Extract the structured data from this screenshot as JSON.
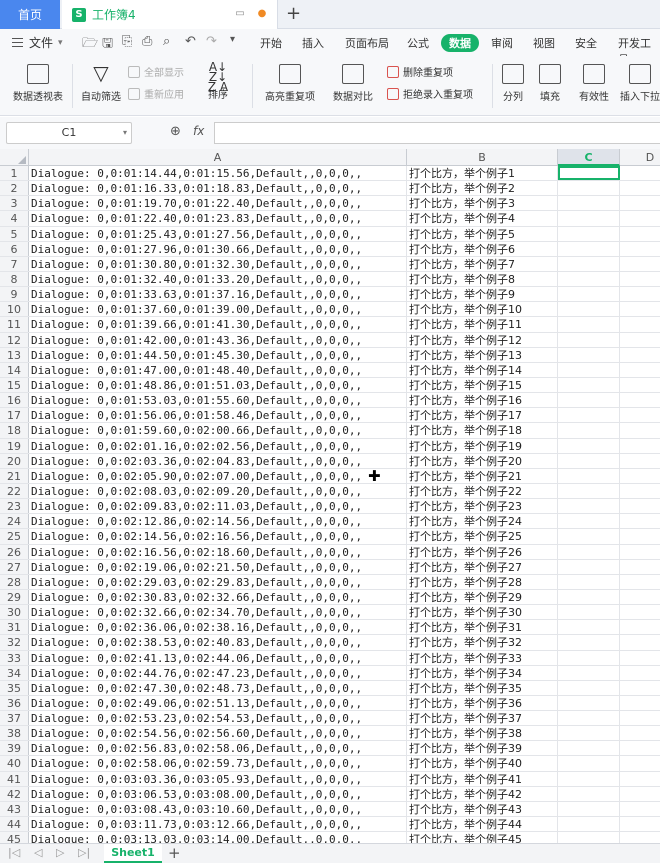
{
  "tabs": {
    "home": "首页",
    "doc_title": "工作簿4",
    "doc_icon": "S"
  },
  "menu": {
    "file": "文件",
    "items": [
      "开始",
      "插入",
      "页面布局",
      "公式",
      "数据",
      "审阅",
      "视图",
      "安全",
      "开发工具"
    ],
    "active": "数据"
  },
  "ribbon": {
    "pivot": "数据透视表",
    "autofilter": "自动筛选",
    "show_all": "全部显示",
    "reapply": "重新应用",
    "sort": "排序",
    "highlight_dup": "高亮重复项",
    "compare": "数据对比",
    "remove_dup": "删除重复项",
    "reject_dup": "拒绝录入重复项",
    "split": "分列",
    "fill": "填充",
    "validity": "有效性",
    "insert_dropdown": "插入下拉"
  },
  "formula_bar": {
    "cell_ref": "C1",
    "fx": "fx",
    "value": ""
  },
  "columns": [
    "A",
    "B",
    "C",
    "D"
  ],
  "selected_column": "C",
  "rows": [
    {
      "n": "1",
      "a": "Dialogue: 0,0:01:14.44,0:01:15.56,Default,,0,0,0,,",
      "b": "打个比方，举个例子1"
    },
    {
      "n": "2",
      "a": "Dialogue: 0,0:01:16.33,0:01:18.83,Default,,0,0,0,,",
      "b": "打个比方，举个例子2"
    },
    {
      "n": "3",
      "a": "Dialogue: 0,0:01:19.70,0:01:22.40,Default,,0,0,0,,",
      "b": "打个比方，举个例子3"
    },
    {
      "n": "4",
      "a": "Dialogue: 0,0:01:22.40,0:01:23.83,Default,,0,0,0,,",
      "b": "打个比方，举个例子4"
    },
    {
      "n": "5",
      "a": "Dialogue: 0,0:01:25.43,0:01:27.56,Default,,0,0,0,,",
      "b": "打个比方，举个例子5"
    },
    {
      "n": "6",
      "a": "Dialogue: 0,0:01:27.96,0:01:30.66,Default,,0,0,0,,",
      "b": "打个比方，举个例子6"
    },
    {
      "n": "7",
      "a": "Dialogue: 0,0:01:30.80,0:01:32.30,Default,,0,0,0,,",
      "b": "打个比方，举个例子7"
    },
    {
      "n": "8",
      "a": "Dialogue: 0,0:01:32.40,0:01:33.20,Default,,0,0,0,,",
      "b": "打个比方，举个例子8"
    },
    {
      "n": "9",
      "a": "Dialogue: 0,0:01:33.63,0:01:37.16,Default,,0,0,0,,",
      "b": "打个比方，举个例子9"
    },
    {
      "n": "10",
      "a": "Dialogue: 0,0:01:37.60,0:01:39.00,Default,,0,0,0,,",
      "b": "打个比方，举个例子10"
    },
    {
      "n": "11",
      "a": "Dialogue: 0,0:01:39.66,0:01:41.30,Default,,0,0,0,,",
      "b": "打个比方，举个例子11"
    },
    {
      "n": "12",
      "a": "Dialogue: 0,0:01:42.00,0:01:43.36,Default,,0,0,0,,",
      "b": "打个比方，举个例子12"
    },
    {
      "n": "13",
      "a": "Dialogue: 0,0:01:44.50,0:01:45.30,Default,,0,0,0,,",
      "b": "打个比方，举个例子13"
    },
    {
      "n": "14",
      "a": "Dialogue: 0,0:01:47.00,0:01:48.40,Default,,0,0,0,,",
      "b": "打个比方，举个例子14"
    },
    {
      "n": "15",
      "a": "Dialogue: 0,0:01:48.86,0:01:51.03,Default,,0,0,0,,",
      "b": "打个比方，举个例子15"
    },
    {
      "n": "16",
      "a": "Dialogue: 0,0:01:53.03,0:01:55.60,Default,,0,0,0,,",
      "b": "打个比方，举个例子16"
    },
    {
      "n": "17",
      "a": "Dialogue: 0,0:01:56.06,0:01:58.46,Default,,0,0,0,,",
      "b": "打个比方，举个例子17"
    },
    {
      "n": "18",
      "a": "Dialogue: 0,0:01:59.60,0:02:00.66,Default,,0,0,0,,",
      "b": "打个比方，举个例子18"
    },
    {
      "n": "19",
      "a": "Dialogue: 0,0:02:01.16,0:02:02.56,Default,,0,0,0,,",
      "b": "打个比方，举个例子19"
    },
    {
      "n": "20",
      "a": "Dialogue: 0,0:02:03.36,0:02:04.83,Default,,0,0,0,,",
      "b": "打个比方，举个例子20"
    },
    {
      "n": "21",
      "a": "Dialogue: 0,0:02:05.90,0:02:07.00,Default,,0,0,0,,",
      "b": "打个比方，举个例子21"
    },
    {
      "n": "22",
      "a": "Dialogue: 0,0:02:08.03,0:02:09.20,Default,,0,0,0,,",
      "b": "打个比方，举个例子22"
    },
    {
      "n": "23",
      "a": "Dialogue: 0,0:02:09.83,0:02:11.03,Default,,0,0,0,,",
      "b": "打个比方，举个例子23"
    },
    {
      "n": "24",
      "a": "Dialogue: 0,0:02:12.86,0:02:14.56,Default,,0,0,0,,",
      "b": "打个比方，举个例子24"
    },
    {
      "n": "25",
      "a": "Dialogue: 0,0:02:14.56,0:02:16.56,Default,,0,0,0,,",
      "b": "打个比方，举个例子25"
    },
    {
      "n": "26",
      "a": "Dialogue: 0,0:02:16.56,0:02:18.60,Default,,0,0,0,,",
      "b": "打个比方，举个例子26"
    },
    {
      "n": "27",
      "a": "Dialogue: 0,0:02:19.06,0:02:21.50,Default,,0,0,0,,",
      "b": "打个比方，举个例子27"
    },
    {
      "n": "28",
      "a": "Dialogue: 0,0:02:29.03,0:02:29.83,Default,,0,0,0,,",
      "b": "打个比方，举个例子28"
    },
    {
      "n": "29",
      "a": "Dialogue: 0,0:02:30.83,0:02:32.66,Default,,0,0,0,,",
      "b": "打个比方，举个例子29"
    },
    {
      "n": "30",
      "a": "Dialogue: 0,0:02:32.66,0:02:34.70,Default,,0,0,0,,",
      "b": "打个比方，举个例子30"
    },
    {
      "n": "31",
      "a": "Dialogue: 0,0:02:36.06,0:02:38.16,Default,,0,0,0,,",
      "b": "打个比方，举个例子31"
    },
    {
      "n": "32",
      "a": "Dialogue: 0,0:02:38.53,0:02:40.83,Default,,0,0,0,,",
      "b": "打个比方，举个例子32"
    },
    {
      "n": "33",
      "a": "Dialogue: 0,0:02:41.13,0:02:44.06,Default,,0,0,0,,",
      "b": "打个比方，举个例子33"
    },
    {
      "n": "34",
      "a": "Dialogue: 0,0:02:44.76,0:02:47.23,Default,,0,0,0,,",
      "b": "打个比方，举个例子34"
    },
    {
      "n": "35",
      "a": "Dialogue: 0,0:02:47.30,0:02:48.73,Default,,0,0,0,,",
      "b": "打个比方，举个例子35"
    },
    {
      "n": "36",
      "a": "Dialogue: 0,0:02:49.06,0:02:51.13,Default,,0,0,0,,",
      "b": "打个比方，举个例子36"
    },
    {
      "n": "37",
      "a": "Dialogue: 0,0:02:53.23,0:02:54.53,Default,,0,0,0,,",
      "b": "打个比方，举个例子37"
    },
    {
      "n": "38",
      "a": "Dialogue: 0,0:02:54.56,0:02:56.60,Default,,0,0,0,,",
      "b": "打个比方，举个例子38"
    },
    {
      "n": "39",
      "a": "Dialogue: 0,0:02:56.83,0:02:58.06,Default,,0,0,0,,",
      "b": "打个比方，举个例子39"
    },
    {
      "n": "40",
      "a": "Dialogue: 0,0:02:58.06,0:02:59.73,Default,,0,0,0,,",
      "b": "打个比方，举个例子40"
    },
    {
      "n": "41",
      "a": "Dialogue: 0,0:03:03.36,0:03:05.93,Default,,0,0,0,,",
      "b": "打个比方，举个例子41"
    },
    {
      "n": "42",
      "a": "Dialogue: 0,0:03:06.53,0:03:08.00,Default,,0,0,0,,",
      "b": "打个比方，举个例子42"
    },
    {
      "n": "43",
      "a": "Dialogue: 0,0:03:08.43,0:03:10.60,Default,,0,0,0,,",
      "b": "打个比方，举个例子43"
    },
    {
      "n": "44",
      "a": "Dialogue: 0,0:03:11.73,0:03:12.66,Default,,0,0,0,,",
      "b": "打个比方，举个例子44"
    },
    {
      "n": "45",
      "a": "Dialogue: 0,0:03:13.03,0:03:14.00,Default,,0,0,0,,",
      "b": "打个比方，举个例子45"
    }
  ],
  "sheet_tabs": [
    "Sheet1"
  ],
  "colors": {
    "accent": "#17b26a",
    "home_tab": "#4a87ee"
  }
}
